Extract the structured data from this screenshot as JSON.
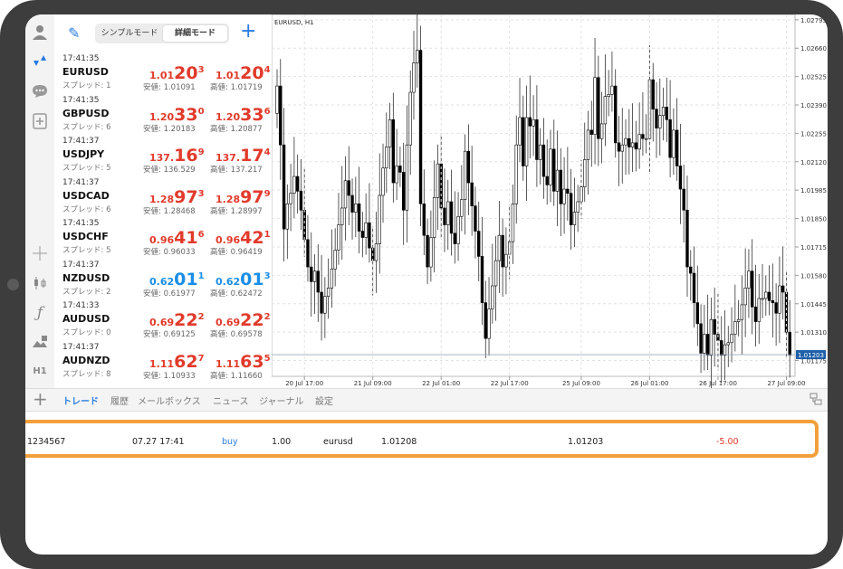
{
  "toolbar": {
    "mode_simple": "シンプルモード",
    "mode_detail": "詳細モード"
  },
  "quotes": [
    {
      "time": "17:41:35",
      "symbol": "EURUSD",
      "spread": "スプレッド: 1",
      "bid_small": "1.01",
      "bid_big": "20",
      "bid_pip": "3",
      "ask_small": "1.01",
      "ask_big": "20",
      "ask_pip": "4",
      "low": "安値: 1.01091",
      "high": "高値: 1.01719",
      "color": "#e23a2b"
    },
    {
      "time": "17:41:35",
      "symbol": "GBPUSD",
      "spread": "スプレッド: 6",
      "bid_small": "1.20",
      "bid_big": "33",
      "bid_pip": "0",
      "ask_small": "1.20",
      "ask_big": "33",
      "ask_pip": "6",
      "low": "安値: 1.20183",
      "high": "高値: 1.20877",
      "color": "#e23a2b"
    },
    {
      "time": "17:41:37",
      "symbol": "USDJPY",
      "spread": "スプレッド: 5",
      "bid_small": "137.",
      "bid_big": "16",
      "bid_pip": "9",
      "ask_small": "137.",
      "ask_big": "17",
      "ask_pip": "4",
      "low": "安値: 136.529",
      "high": "高値: 137.217",
      "color": "#e23a2b"
    },
    {
      "time": "17:41:37",
      "symbol": "USDCAD",
      "spread": "スプレッド: 6",
      "bid_small": "1.28",
      "bid_big": "97",
      "bid_pip": "3",
      "ask_small": "1.28",
      "ask_big": "97",
      "ask_pip": "9",
      "low": "安値: 1.28468",
      "high": "高値: 1.28997",
      "color": "#e23a2b"
    },
    {
      "time": "17:41:35",
      "symbol": "USDCHF",
      "spread": "スプレッド: 5",
      "bid_small": "0.96",
      "bid_big": "41",
      "bid_pip": "6",
      "ask_small": "0.96",
      "ask_big": "42",
      "ask_pip": "1",
      "low": "安値: 0.96033",
      "high": "高値: 0.96419",
      "color": "#e23a2b"
    },
    {
      "time": "17:41:37",
      "symbol": "NZDUSD",
      "spread": "スプレッド: 2",
      "bid_small": "0.62",
      "bid_big": "01",
      "bid_pip": "1",
      "ask_small": "0.62",
      "ask_big": "01",
      "ask_pip": "3",
      "low": "安値: 0.61977",
      "high": "高値: 0.62472",
      "color": "#1a8ee6"
    },
    {
      "time": "17:41:33",
      "symbol": "AUDUSD",
      "spread": "スプレッド: 0",
      "bid_small": "0.69",
      "bid_big": "22",
      "bid_pip": "2",
      "ask_small": "0.69",
      "ask_big": "22",
      "ask_pip": "2",
      "low": "安値: 0.69125",
      "high": "高値: 0.69578",
      "color": "#e23a2b"
    },
    {
      "time": "17:41:37",
      "symbol": "AUDNZD",
      "spread": "スプレッド: 8",
      "bid_small": "1.11",
      "bid_big": "62",
      "bid_pip": "7",
      "ask_small": "1.11",
      "ask_big": "63",
      "ask_pip": "5",
      "low": "安値: 1.10933",
      "high": "高値: 1.11660",
      "color": "#e23a2b"
    }
  ],
  "chart": {
    "title": "EURUSD, H1",
    "current_price": "1.01203"
  },
  "chart_data": {
    "type": "candlestick",
    "title": "EURUSD, H1",
    "y_ticks": [
      "1.02795",
      "1.02660",
      "1.02525",
      "1.02390",
      "1.02255",
      "1.02120",
      "1.01985",
      "1.01850",
      "1.01715",
      "1.01580",
      "1.01445",
      "1.01310",
      "1.01175"
    ],
    "x_ticks": [
      "20 Jul 17:00",
      "21 Jul 09:00",
      "22 Jul 01:00",
      "22 Jul 17:00",
      "25 Jul 09:00",
      "26 Jul 01:00",
      "26 Jul 17:00",
      "27 Jul 09:00"
    ],
    "ylim": [
      1.011,
      1.0282
    ],
    "last": 1.01203,
    "close": [
      1.0248,
      1.022,
      1.018,
      1.0192,
      1.0197,
      1.0205,
      1.0198,
      1.0189,
      1.0175,
      1.0162,
      1.0155,
      1.016,
      1.015,
      1.014,
      1.0148,
      1.0152,
      1.0161,
      1.017,
      1.0182,
      1.019,
      1.0203,
      1.0196,
      1.0188,
      1.0192,
      1.0179,
      1.0176,
      1.0183,
      1.0171,
      1.0165,
      1.0173,
      1.0196,
      1.0209,
      1.0219,
      1.0232,
      1.0202,
      1.021,
      1.0207,
      1.0189,
      1.022,
      1.0245,
      1.0259,
      1.0265,
      1.0192,
      1.0177,
      1.0162,
      1.0176,
      1.0195,
      1.0211,
      1.019,
      1.0182,
      1.0193,
      1.0178,
      1.0173,
      1.0186,
      1.0194,
      1.0217,
      1.0202,
      1.0191,
      1.0179,
      1.0167,
      1.0145,
      1.0128,
      1.0142,
      1.0153,
      1.0165,
      1.0177,
      1.0162,
      1.0168,
      1.0174,
      1.0192,
      1.022,
      1.0233,
      1.021,
      1.0233,
      1.0229,
      1.0232,
      1.0213,
      1.022,
      1.0205,
      1.0201,
      1.0218,
      1.0198,
      1.0208,
      1.0192,
      1.0199,
      1.0197,
      1.0182,
      1.0188,
      1.0193,
      1.02,
      1.0213,
      1.0227,
      1.0225,
      1.0252,
      1.0223,
      1.023,
      1.0243,
      1.0244,
      1.0248,
      1.0221,
      1.0217,
      1.022,
      1.0223,
      1.0219,
      1.0221,
      1.0218,
      1.0225,
      1.0223,
      1.0223,
      1.0251,
      1.0237,
      1.0228,
      1.0234,
      1.0238,
      1.0232,
      1.0214,
      1.0227,
      1.021,
      1.0199,
      1.0189,
      1.0162,
      1.0159,
      1.0145,
      1.0135,
      1.0121,
      1.013,
      1.012,
      1.0137,
      1.013,
      1.0127,
      1.012,
      1.0125,
      1.0126,
      1.013,
      1.0136,
      1.0137,
      1.0144,
      1.0152,
      1.016,
      1.0143,
      1.0136,
      1.0147,
      1.0147,
      1.015,
      1.0146,
      1.0145,
      1.014,
      1.0153,
      1.015,
      1.0131,
      1.012
    ]
  },
  "tabs": [
    "トレード",
    "履歴",
    "メールボックス",
    "ニュース",
    "ジャーナル",
    "設定"
  ],
  "trade": {
    "ticket": "1234567",
    "time": "07.27 17:41",
    "type": "buy",
    "volume": "1.00",
    "symbol": "eurusd",
    "open_price": "1.01208",
    "current_price": "1.01203",
    "profit": "-5.00",
    "buy_color": "#2a7de1",
    "profit_color": "#e23a2b"
  },
  "icons": [
    "account-icon",
    "quotes-icon",
    "chat-icon",
    "new-order-icon",
    "crosshair-icon",
    "indicators-icon",
    "function-icon",
    "objects-icon",
    "timeframe-icon"
  ],
  "timeframe_label": "H1"
}
